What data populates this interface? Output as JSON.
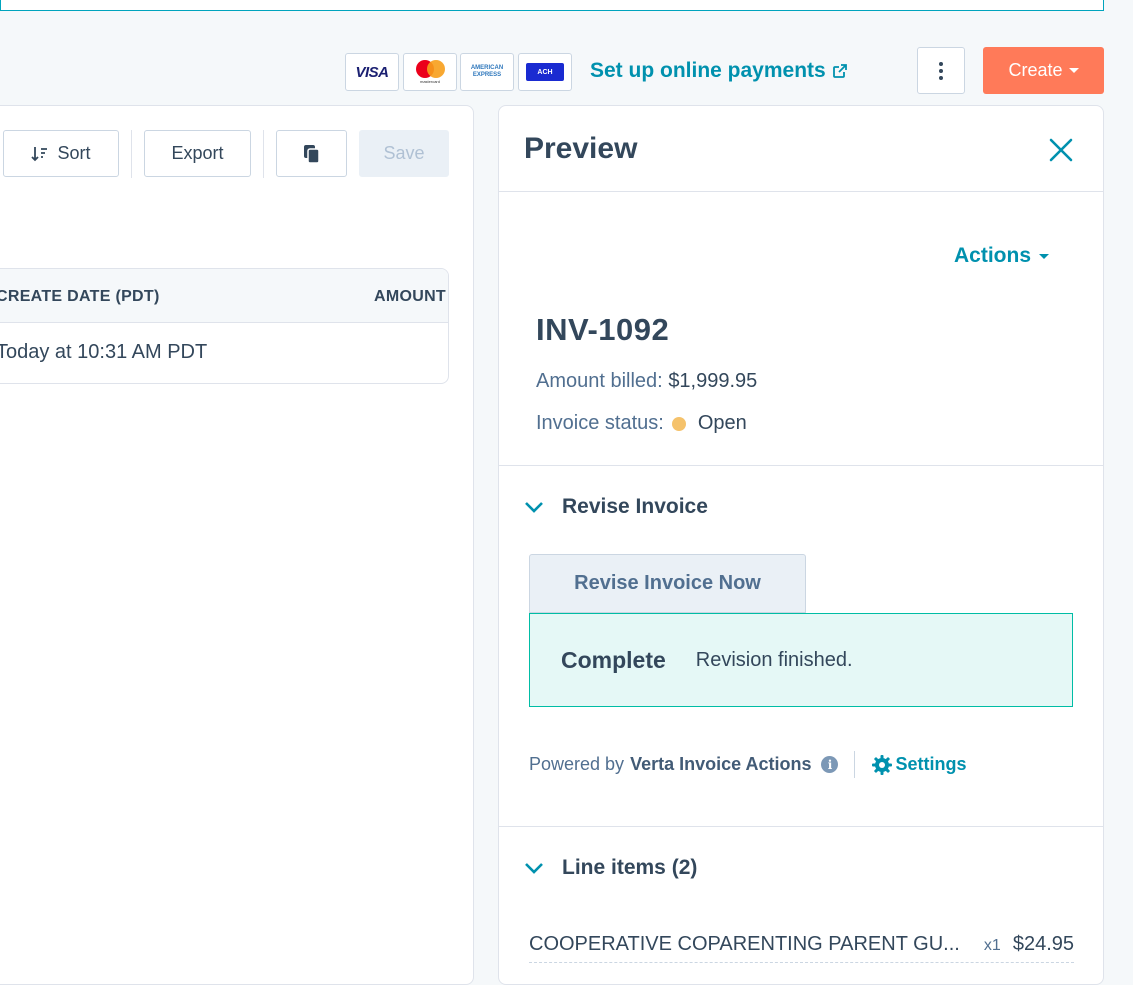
{
  "header": {
    "cards": {
      "visa": "VISA",
      "mastercard": "mastercard",
      "amex_line1": "AMERICAN",
      "amex_line2": "EXPRESS",
      "ach": "ACH"
    },
    "setup_link": "Set up online payments",
    "create_label": "Create",
    "colors": {
      "create": "#ff7a59",
      "link": "#0091ae"
    }
  },
  "toolbar": {
    "sort_label": "Sort",
    "export_label": "Export",
    "save_label": "Save"
  },
  "table": {
    "columns": [
      "CREATE DATE (PDT)",
      "AMOUNT"
    ],
    "rows": [
      {
        "create_date": "Today at 10:31 AM PDT",
        "amount": ""
      }
    ]
  },
  "preview": {
    "title": "Preview",
    "actions_label": "Actions",
    "invoice_number": "INV-1092",
    "amount_label": "Amount billed:",
    "amount_value": "$1,999.95",
    "status_label": "Invoice status:",
    "status_value": "Open",
    "status_color": "#f5c26b",
    "revise_section": {
      "title": "Revise Invoice",
      "button_label": "Revise Invoice Now",
      "result_title": "Complete",
      "result_message": "Revision finished.",
      "powered_prefix": "Powered by",
      "powered_brand": "Verta Invoice Actions",
      "settings_label": "Settings"
    },
    "line_items_section": {
      "title": "Line items (2)",
      "items": [
        {
          "name": "COOPERATIVE COPARENTING PARENT GU...",
          "qty": "x1",
          "price": "$24.95"
        }
      ]
    }
  }
}
